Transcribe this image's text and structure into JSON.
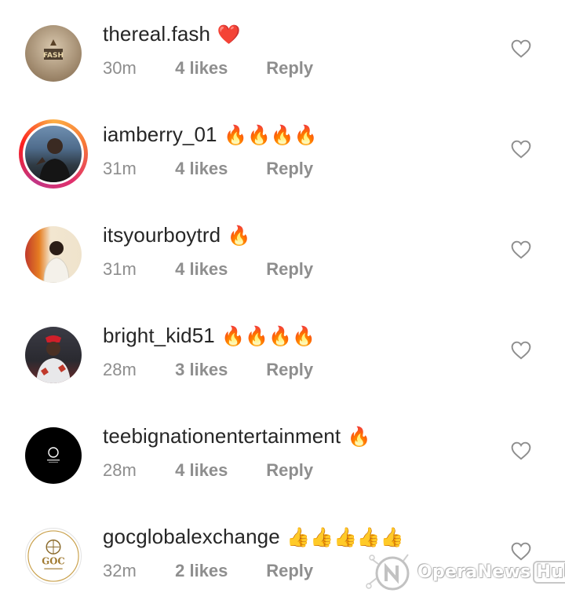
{
  "comments": [
    {
      "username": "thereal.fash",
      "emoji": "❤️",
      "time": "30m",
      "likes": "4 likes",
      "reply": "Reply",
      "avatar": "thereal-fash-logo-avatar",
      "avatar_logo_text": "FASH"
    },
    {
      "username": "iamberry_01",
      "emoji": "🔥🔥🔥🔥",
      "time": "31m",
      "likes": "4 likes",
      "reply": "Reply",
      "avatar": "iamberry-photo-avatar-story-ring"
    },
    {
      "username": "itsyourboytrd",
      "emoji": "🔥",
      "time": "31m",
      "likes": "4 likes",
      "reply": "Reply",
      "avatar": "itsyourboytrd-photo-avatar"
    },
    {
      "username": "bright_kid51",
      "emoji": "🔥🔥🔥🔥",
      "time": "28m",
      "likes": "3 likes",
      "reply": "Reply",
      "avatar": "bright-kid-photo-avatar"
    },
    {
      "username": "teebignationentertainment",
      "emoji": "🔥",
      "time": "28m",
      "likes": "4 likes",
      "reply": "Reply",
      "avatar": "teebig-logo-avatar"
    },
    {
      "username": "gocglobalexchange",
      "emoji": "👍👍👍👍👍",
      "time": "32m",
      "likes": "2 likes",
      "reply": "Reply",
      "avatar": "goc-logo-avatar",
      "avatar_logo_text": "GOC"
    }
  ],
  "watermark": {
    "text": "OperaNews",
    "hub": "Hub"
  },
  "colors": {
    "primary_text": "#262626",
    "secondary_text": "#8e8e8e",
    "heart_outline": "#8e8e8e"
  }
}
